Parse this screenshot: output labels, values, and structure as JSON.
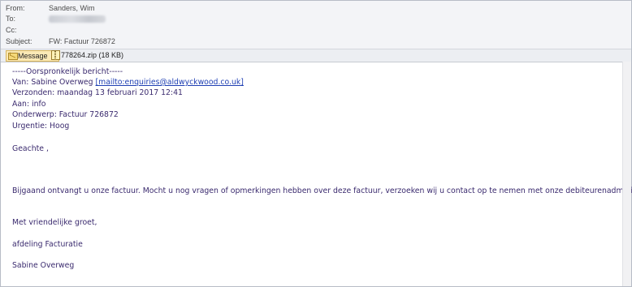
{
  "header": {
    "from_label": "From:",
    "from_value": "Sanders, Wim",
    "to_label": "To:",
    "cc_label": "Cc:",
    "subject_label": "Subject:",
    "subject_value": "FW: Factuur 726872"
  },
  "attachments": {
    "message_tab": "Message",
    "file": "778264.zip (18 KB)"
  },
  "body": {
    "separator": "-----Oorspronkelijk bericht-----",
    "van_prefix": "Van: Sabine Overweg ",
    "van_link": "[mailto:enquiries@aldwyckwood.co.uk]",
    "verzonden": "Verzonden: maandag 13 februari 2017 12:41",
    "aan": "Aan: info",
    "onderwerp": "Onderwerp: Factuur 726872",
    "urgentie": "Urgentie: Hoog",
    "greeting": "Geachte ,",
    "paragraph": "Bijgaand ontvangt u onze factuur. Mocht u nog vragen of opmerkingen hebben over deze factuur, verzoeken wij u contact op te nemen met onze debiteurenadministratie.",
    "closing": "Met vriendelijke groet,",
    "department": "afdeling Facturatie",
    "signature": "Sabine Overweg"
  },
  "colors": {
    "body_text": "#3a2a6e",
    "link": "#1f3fb3",
    "header_bg": "#f3f4f7"
  }
}
